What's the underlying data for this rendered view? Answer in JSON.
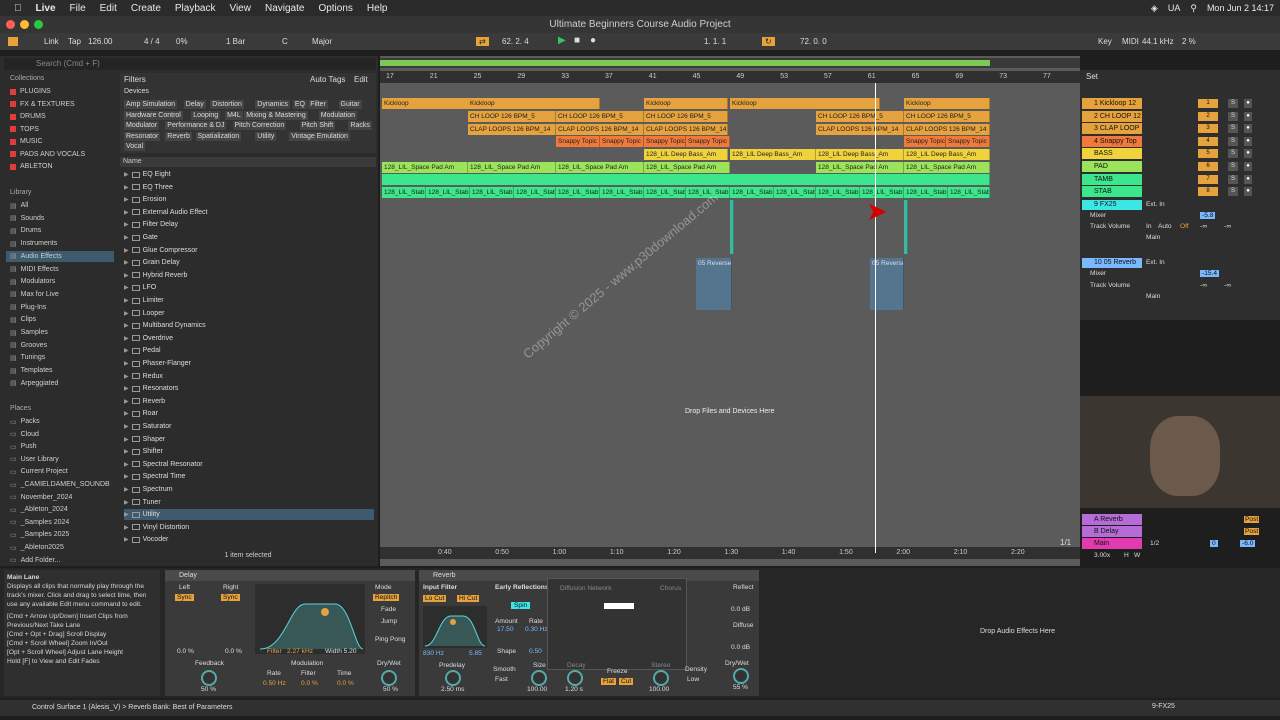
{
  "menubar": {
    "app": "Live",
    "items": [
      "File",
      "Edit",
      "Create",
      "Playback",
      "View",
      "Navigate",
      "Options",
      "Help"
    ],
    "right": [
      "UA",
      "Mon Jun 2  14:17"
    ]
  },
  "title": "Ultimate Beginners Course Audio Project",
  "toolbar": {
    "link": "Link",
    "tap": "Tap",
    "tempo": "126.00",
    "sig": "4 / 4",
    "pct": "0%",
    "quant": "1 Bar",
    "key": "C",
    "scale": "Major",
    "pos": "62.  2.  4",
    "pos2": "1.  1.  1",
    "pos3": "72.  0.  0",
    "key_btn": "Key",
    "midi": "MIDI",
    "rate": "44.1 kHz",
    "cpu": "2 %"
  },
  "browser": {
    "search_placeholder": "Search (Cmd + F)",
    "collections_lbl": "Collections",
    "collections": [
      {
        "label": "PLUGINS",
        "color": "#e23b3b"
      },
      {
        "label": "FX & TEXTURES",
        "color": "#e23b3b"
      },
      {
        "label": "DRUMS",
        "color": "#e23b3b"
      },
      {
        "label": "TOPS",
        "color": "#e23b3b"
      },
      {
        "label": "MUSIC",
        "color": "#e23b3b"
      },
      {
        "label": "PADS AND VOCALS",
        "color": "#e23b3b"
      },
      {
        "label": "ABLETON",
        "color": "#e23b3b"
      }
    ],
    "library_lbl": "Library",
    "library": [
      "All",
      "Sounds",
      "Drums",
      "Instruments",
      "Audio Effects",
      "MIDI Effects",
      "Modulators",
      "Max for Live",
      "Plug-Ins",
      "Clips",
      "Samples",
      "Grooves",
      "Tunings",
      "Templates",
      "Arpeggiated"
    ],
    "places_lbl": "Places",
    "places": [
      "Packs",
      "Cloud",
      "Push",
      "User Library",
      "Current Project",
      "_CAMIELDAMEN_SOUNDB",
      "November_2024",
      "_Ableton_2024",
      "_Samples 2024",
      "_Samples 2025",
      "_Ableton2025",
      "Add Folder..."
    ],
    "filters": "Filters",
    "autotags": "Auto Tags",
    "edit": "Edit",
    "devices": "Devices",
    "tags": [
      "Amp Simulation",
      "Delay",
      "Distortion",
      "Dynamics",
      "EQ",
      "Filter",
      "Guitar",
      "Hardware Control",
      "Looping",
      "M4L",
      "Mixing & Mastering",
      "Modulation",
      "Modulator",
      "Performance & DJ",
      "Pitch Correction",
      "Pitch Shift",
      "Racks",
      "Resonator",
      "Reverb",
      "Spatialization",
      "Utility",
      "Vintage Emulation",
      "Vocal"
    ],
    "name_hdr": "Name",
    "devices_list": [
      "EQ Eight",
      "EQ Three",
      "Erosion",
      "External Audio Effect",
      "Filter Delay",
      "Gate",
      "Glue Compressor",
      "Grain Delay",
      "Hybrid Reverb",
      "LFO",
      "Limiter",
      "Looper",
      "Multiband Dynamics",
      "Overdrive",
      "Pedal",
      "Phaser-Flanger",
      "Redux",
      "Resonators",
      "Reverb",
      "Roar",
      "Saturator",
      "Shaper",
      "Shifter",
      "Spectral Resonator",
      "Spectral Time",
      "Spectrum",
      "Tuner",
      "Utility",
      "Vinyl Distortion",
      "Vocoder"
    ],
    "status": "1 item selected"
  },
  "arrangement": {
    "ruler": [
      "17",
      "21",
      "25",
      "29",
      "33",
      "37",
      "41",
      "45",
      "49",
      "53",
      "57",
      "61",
      "65",
      "69",
      "73",
      "77"
    ],
    "time": [
      "0:40",
      "0:50",
      "1:00",
      "1:10",
      "1:20",
      "1:30",
      "1:40",
      "1:50",
      "2:00",
      "2:10",
      "2:20"
    ],
    "clips_kick": "Kickloop",
    "clips_ch": "CH LOOP 126 BPM_5",
    "clips_clap": "CLAP LOOPS 126 BPM_14",
    "clips_snap": "Snappy Topic",
    "clips_bass": "128_LIL Deep Bass_Am",
    "clips_pad": "128_LIL_Space Pad Am",
    "clips_stab": "128_LIL_Stab",
    "reverse": "05 Reverse",
    "drop": "Drop Files and Devices Here",
    "watermark": "Copyright © 2025 - www.p30download.com"
  },
  "mixer": {
    "set": "Set",
    "tracks": [
      {
        "name": "1 Kickloop 12",
        "num": "1",
        "color": "#e6a23c"
      },
      {
        "name": "2 CH LOOP 12",
        "num": "2",
        "color": "#e6a23c"
      },
      {
        "name": "3 CLAP LOOP",
        "num": "3",
        "color": "#e6a23c"
      },
      {
        "name": "4 Snappy Top",
        "num": "4",
        "color": "#f07a3c"
      },
      {
        "name": "BASS",
        "num": "5",
        "color": "#f0d23c"
      },
      {
        "name": "PAD",
        "num": "6",
        "color": "#9be35a"
      },
      {
        "name": "TAMB",
        "num": "7",
        "color": "#3ce68c"
      },
      {
        "name": "STAB",
        "num": "8",
        "color": "#3ce68c"
      }
    ],
    "fx_a": "9 FX25",
    "fx_b": "10 05 Reverb",
    "mixer_lbl": "Mixer",
    "track_move": "Track Volume",
    "ext_in": "Ext. In",
    "auto": "Auto",
    "off": "Off",
    "main": "Main",
    "in": "In",
    "vol_a": "-5.8",
    "vol_b": "-15.4",
    "inf": "-∞",
    "returns": [
      {
        "name": "A Reverb",
        "color": "#b66cd6"
      },
      {
        "name": "B Delay",
        "color": "#b66cd6"
      },
      {
        "name": "Main",
        "color": "#e23bb0"
      }
    ],
    "main_vol": "0",
    "main_db": "-6.0",
    "ratio": "1/1",
    "zoom": "3.00x",
    "hw": "H",
    "w": "W",
    "half": "1/2",
    "post": "Post"
  },
  "info": {
    "title": "Main Lane",
    "text": "Displays all clips that normally play through the track's mixer. Click and drag to select time, then use any available Edit menu command to edit.",
    "shortcuts": [
      "[Cmd + Arrow Up/Down] Insert Clips from Previous/Next Take Lane",
      "[Cmd + Opt + Drag] Scroll Display",
      "[Cmd + Scroll Wheel] Zoom In/Out",
      "[Opt + Scroll Wheel] Adjust Lane Height",
      "Hold [F] to View and Edit Fades"
    ]
  },
  "delay": {
    "title": "Delay",
    "left": "Left",
    "right": "Right",
    "sync": "Sync",
    "mode": "Mode",
    "repitch": "Repitch",
    "fade": "Fade",
    "jump": "Jump",
    "pingpong": "Ping Pong",
    "filter": "Filter",
    "freq": "2.27 kHz",
    "width": "Width 5.20",
    "feedback": "Feedback",
    "fb_val": "50 %",
    "modulation": "Modulation",
    "rate": "Rate",
    "rate_val": "0.50 Hz",
    "mod_filter": "Filter",
    "filter_val": "0.0 %",
    "time": "Time",
    "time_val": "0.0 %",
    "drywet": "Dry/Wet",
    "dw_val": "50 %",
    "zero_l": "0.0 %",
    "zero_r": "0.0 %"
  },
  "reverb": {
    "title": "Reverb",
    "input": "Input Filter",
    "locut": "Lo Cut",
    "hicut": "Hi Cut",
    "early": "Early Reflections",
    "spin": "Spin",
    "amount": "Amount",
    "amount_val": "17.50",
    "rate": "Rate",
    "rate_val": "0.30 Hz",
    "shape": "Shape",
    "shape_val": "0.50",
    "diffusion": "Diffusion Network",
    "chorus": "Chorus",
    "freq": "830 Hz",
    "width": "5.85",
    "predelay": "Predelay",
    "pd_val": "2.50 ms",
    "smooth": "Smooth",
    "smooth_val": "Fast",
    "size": "Size",
    "size_val": "100.00",
    "decay": "Decay",
    "decay_val": "1.20 s",
    "freeze": "Freeze",
    "flat": "Flat",
    "cut": "Cut",
    "stereo": "Stereo",
    "stereo_val": "100.00",
    "density": "Density",
    "density_val": "Low",
    "reflect": "Reflect",
    "diffuse": "Diffuse",
    "drywet": "Dry/Wet",
    "dw_val": "55 %",
    "db1": "0.0 dB",
    "db2": "0.0 dB"
  },
  "drop_fx": "Drop Audio Effects Here",
  "status": "Control Surface 1 (Alesis_V) > Reverb Bank: Best of Parameters",
  "status_right": "9-FX25"
}
